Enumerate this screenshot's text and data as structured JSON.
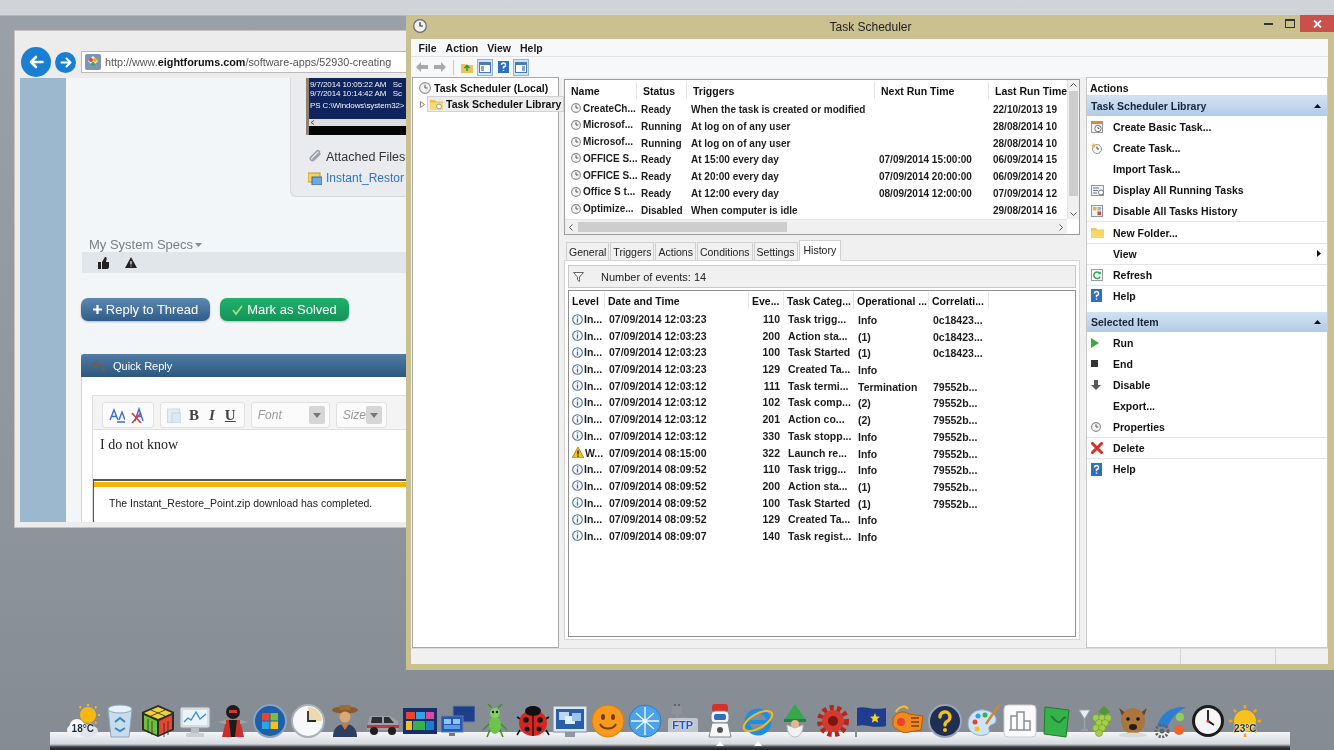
{
  "browser": {
    "url": "http://www.**eightforums.com**/software-apps/52930-creating",
    "screenshot_lines": [
      "9/7/2014 10:05:22 AM   Sc",
      "9/7/2014 10:14:42 AM   Sc",
      "PS C:\\Windows\\system32>"
    ],
    "attached_files": "Attached Files",
    "attachment": "Instant_Restor",
    "system_specs": "My System Specs",
    "buttons": [
      {
        "kind": "reply",
        "label": "Reply to Thread"
      },
      {
        "kind": "solved",
        "label": "Mark as Solved"
      }
    ],
    "quick_reply": {
      "title": "Quick Reply",
      "format_buttons": [
        {
          "kind": "bold",
          "label": "B"
        },
        {
          "kind": "italic",
          "label": "I"
        },
        {
          "kind": "underline",
          "label": "U"
        }
      ],
      "selects": [
        {
          "placeholder": "Font"
        },
        {
          "placeholder": "Size"
        }
      ],
      "value": "I do not know"
    },
    "download_message": "The Instant_Restore_Point.zip download has completed."
  },
  "task_scheduler": {
    "title": "Task Scheduler",
    "menu": [
      "File",
      "Action",
      "View",
      "Help"
    ],
    "toolbar": [
      [
        {
          "kind": "back",
          "disabled": true,
          "pressed": false
        },
        {
          "kind": "forward",
          "disabled": true,
          "pressed": false
        }
      ],
      [
        {
          "kind": "up",
          "disabled": false,
          "pressed": false
        },
        {
          "kind": "tree",
          "disabled": false,
          "pressed": true
        },
        {
          "kind": "help",
          "disabled": false,
          "pressed": false
        },
        {
          "kind": "pane",
          "disabled": false,
          "pressed": true
        }
      ]
    ],
    "tree": [
      {
        "label": "Task Scheduler (Local)",
        "selected": false,
        "children": [
          {
            "label": "Task Scheduler Library",
            "selected": true,
            "expanded": false
          }
        ]
      }
    ],
    "tasks": {
      "columns": [
        "Name",
        "Status",
        "Triggers",
        "Next Run Time",
        "Last Run Time"
      ],
      "rows": [
        {
          "name": "CreateCh...",
          "status": "Ready",
          "triggers": "When the task is created or modified",
          "last_run": "22/10/2013 19"
        },
        {
          "name": "Microsof...",
          "status": "Running",
          "triggers": "At log on of any user",
          "last_run": "28/08/2014 10"
        },
        {
          "name": "Microsof...",
          "status": "Running",
          "triggers": "At log on of any user",
          "last_run": "28/08/2014 10"
        },
        {
          "name": "OFFICE S...",
          "status": "Ready",
          "triggers": "At 15:00 every day",
          "next_run": "07/09/2014 15:00:00",
          "last_run": "06/09/2014 15"
        },
        {
          "name": "OFFICE S...",
          "status": "Ready",
          "triggers": "At 20:00 every day",
          "next_run": "07/09/2014 20:00:00",
          "last_run": "06/09/2014 20"
        },
        {
          "name": "Office S t...",
          "status": "Ready",
          "triggers": "At 12:00 every day",
          "next_run": "08/09/2014 12:00:00",
          "last_run": "07/09/2014 12"
        },
        {
          "name": "Optimize...",
          "status": "Disabled",
          "triggers": "When computer is idle",
          "last_run": "29/08/2014 16"
        }
      ]
    },
    "tabs": [
      {
        "label": "General",
        "selected": false
      },
      {
        "label": "Triggers",
        "selected": false
      },
      {
        "label": "Actions",
        "selected": false
      },
      {
        "label": "Conditions",
        "selected": false
      },
      {
        "label": "Settings",
        "selected": false
      },
      {
        "label": "History",
        "selected": true
      }
    ],
    "history": {
      "event_count": "Number of events: 14",
      "columns": [
        "Level",
        "Date and Time",
        "Eve...",
        "Task Categ...",
        "Operational ...",
        "Correlati..."
      ],
      "rows": [
        {
          "kind": "info",
          "level": "In...",
          "date": "07/09/2014 12:03:23",
          "event_id": "110",
          "category": "Task trigg...",
          "operational": "Info",
          "correlation": "0c18423..."
        },
        {
          "kind": "info",
          "level": "In...",
          "date": "07/09/2014 12:03:23",
          "event_id": "200",
          "category": "Action sta...",
          "operational": "(1)",
          "correlation": "0c18423..."
        },
        {
          "kind": "info",
          "level": "In...",
          "date": "07/09/2014 12:03:23",
          "event_id": "100",
          "category": "Task Started",
          "operational": "(1)",
          "correlation": "0c18423..."
        },
        {
          "kind": "info",
          "level": "In...",
          "date": "07/09/2014 12:03:23",
          "event_id": "129",
          "category": "Created Ta...",
          "operational": "Info"
        },
        {
          "kind": "info",
          "level": "In...",
          "date": "07/09/2014 12:03:12",
          "event_id": "111",
          "category": "Task termi...",
          "operational": "Termination",
          "correlation": "79552b..."
        },
        {
          "kind": "info",
          "level": "In...",
          "date": "07/09/2014 12:03:12",
          "event_id": "102",
          "category": "Task comp...",
          "operational": "(2)",
          "correlation": "79552b..."
        },
        {
          "kind": "info",
          "level": "In...",
          "date": "07/09/2014 12:03:12",
          "event_id": "201",
          "category": "Action co...",
          "operational": "(2)",
          "correlation": "79552b..."
        },
        {
          "kind": "info",
          "level": "In...",
          "date": "07/09/2014 12:03:12",
          "event_id": "330",
          "category": "Task stopp...",
          "operational": "Info",
          "correlation": "79552b..."
        },
        {
          "kind": "warning",
          "level": "W...",
          "date": "07/09/2014 08:15:00",
          "event_id": "322",
          "category": "Launch re...",
          "operational": "Info",
          "correlation": "79552b..."
        },
        {
          "kind": "info",
          "level": "In...",
          "date": "07/09/2014 08:09:52",
          "event_id": "110",
          "category": "Task trigg...",
          "operational": "Info",
          "correlation": "79552b..."
        },
        {
          "kind": "info",
          "level": "In...",
          "date": "07/09/2014 08:09:52",
          "event_id": "200",
          "category": "Action sta...",
          "operational": "(1)",
          "correlation": "79552b..."
        },
        {
          "kind": "info",
          "level": "In...",
          "date": "07/09/2014 08:09:52",
          "event_id": "100",
          "category": "Task Started",
          "operational": "(1)",
          "correlation": "79552b..."
        },
        {
          "kind": "info",
          "level": "In...",
          "date": "07/09/2014 08:09:52",
          "event_id": "129",
          "category": "Created Ta...",
          "operational": "Info"
        },
        {
          "kind": "info",
          "level": "In...",
          "date": "07/09/2014 08:09:07",
          "event_id": "140",
          "category": "Task regist...",
          "operational": "Info"
        }
      ]
    },
    "actions": {
      "title": "Actions",
      "sections": [
        {
          "title": "Task Scheduler Library",
          "expanded": true,
          "items": [
            {
              "kind": "basic-task",
              "label": "Create Basic Task...",
              "divider": false
            },
            {
              "kind": "task",
              "label": "Create Task...",
              "divider": false
            },
            {
              "kind": "plain",
              "label": "Import Task...",
              "divider": false
            },
            {
              "kind": "running",
              "label": "Display All Running Tasks",
              "divider": false
            },
            {
              "kind": "history",
              "label": "Disable All Tasks History",
              "divider": true
            },
            {
              "kind": "folder",
              "label": "New Folder...",
              "divider": true
            },
            {
              "kind": "submenu",
              "label": "View",
              "divider": true
            },
            {
              "kind": "refresh",
              "label": "Refresh",
              "divider": true
            },
            {
              "kind": "help",
              "label": "Help",
              "divider": false
            }
          ]
        },
        {
          "title": "Selected Item",
          "expanded": true,
          "items": [
            {
              "kind": "run",
              "label": "Run",
              "divider": false
            },
            {
              "kind": "end",
              "label": "End",
              "divider": false
            },
            {
              "kind": "disable",
              "label": "Disable",
              "divider": false
            },
            {
              "kind": "plain",
              "label": "Export...",
              "divider": false
            },
            {
              "kind": "properties",
              "label": "Properties",
              "divider": true
            },
            {
              "kind": "delete",
              "label": "Delete",
              "divider": true
            },
            {
              "kind": "help",
              "label": "Help",
              "divider": false
            }
          ]
        }
      ]
    }
  },
  "dock": [
    {
      "kind": "weather",
      "label": "18°C",
      "running": false
    },
    {
      "kind": "trash",
      "running": false
    },
    {
      "kind": "cube",
      "running": false
    },
    {
      "kind": "monitor",
      "running": false
    },
    {
      "kind": "figure",
      "running": false
    },
    {
      "kind": "orb",
      "running": false
    },
    {
      "kind": "clock",
      "running": false
    },
    {
      "kind": "cowboy",
      "running": false
    },
    {
      "kind": "car",
      "running": false
    },
    {
      "kind": "tiles",
      "running": false
    },
    {
      "kind": "screens",
      "running": false
    },
    {
      "kind": "grasshopper",
      "running": false
    },
    {
      "kind": "ladybug",
      "running": false
    },
    {
      "kind": "windows",
      "running": false
    },
    {
      "kind": "smiley",
      "running": false
    },
    {
      "kind": "globe",
      "running": false
    },
    {
      "kind": "ftp",
      "label": "FTP",
      "running": false
    },
    {
      "kind": "robot",
      "running": true
    },
    {
      "kind": "browser",
      "running": true
    },
    {
      "kind": "gnome",
      "running": false
    },
    {
      "kind": "gear",
      "running": false
    },
    {
      "kind": "flag",
      "running": false
    },
    {
      "kind": "gadget",
      "running": false
    },
    {
      "kind": "help",
      "running": false
    },
    {
      "kind": "palette",
      "running": false
    },
    {
      "kind": "tile",
      "running": false
    },
    {
      "kind": "card",
      "running": false
    },
    {
      "kind": "grapes",
      "running": false
    },
    {
      "kind": "dog",
      "running": false
    },
    {
      "kind": "network",
      "running": false
    },
    {
      "kind": "watch",
      "running": false
    },
    {
      "kind": "sun",
      "label": "23°C",
      "running": false
    }
  ]
}
